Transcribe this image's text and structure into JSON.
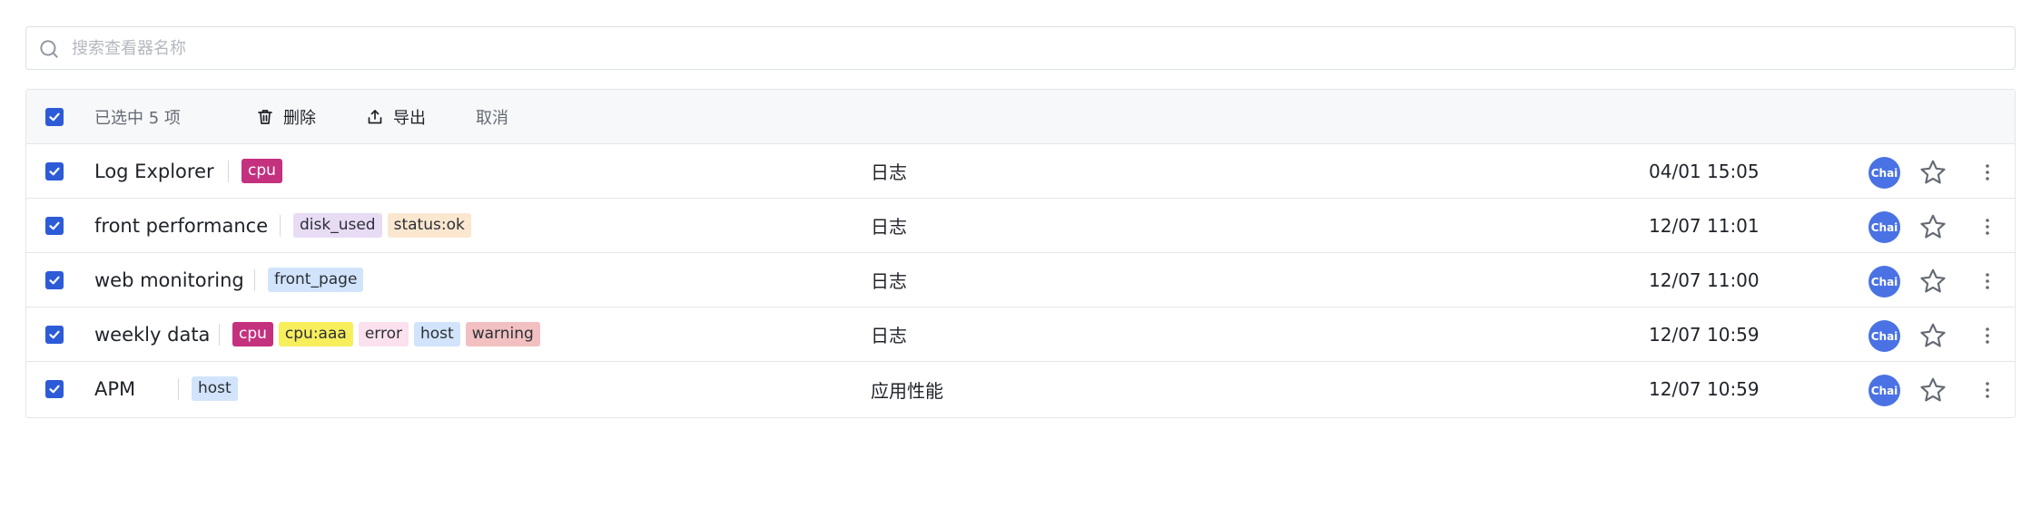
{
  "search": {
    "placeholder": "搜索查看器名称",
    "value": ""
  },
  "toolbar": {
    "selected_text": "已选中 5 项",
    "delete_label": "删除",
    "export_label": "导出",
    "cancel_label": "取消",
    "select_all_checked": true
  },
  "rows": [
    {
      "checked": true,
      "name": "Log Explorer",
      "tags": [
        {
          "text": "cpu",
          "bg": "#c4317e",
          "fg": "#ffffff"
        }
      ],
      "type": "日志",
      "time": "04/01 15:05",
      "avatar": "Chai"
    },
    {
      "checked": true,
      "name": "front performance",
      "tags": [
        {
          "text": "disk_used",
          "bg": "#e8dcf5",
          "fg": "#2b2f36"
        },
        {
          "text": "status:ok",
          "bg": "#fbe7cf",
          "fg": "#2b2f36"
        }
      ],
      "type": "日志",
      "time": "12/07 11:01",
      "avatar": "Chai"
    },
    {
      "checked": true,
      "name": "web monitoring",
      "tags": [
        {
          "text": "front_page",
          "bg": "#d2e4fb",
          "fg": "#2b2f36"
        }
      ],
      "type": "日志",
      "time": "12/07 11:00",
      "avatar": "Chai"
    },
    {
      "checked": true,
      "name": "weekly data",
      "tags": [
        {
          "text": "cpu",
          "bg": "#c4317e",
          "fg": "#ffffff"
        },
        {
          "text": "cpu:aaa",
          "bg": "#f7ee5c",
          "fg": "#2b2f36"
        },
        {
          "text": "error",
          "bg": "#fbe0ee",
          "fg": "#2b2f36"
        },
        {
          "text": "host",
          "bg": "#d2e4fb",
          "fg": "#2b2f36"
        },
        {
          "text": "warning",
          "bg": "#f2c0c0",
          "fg": "#2b2f36"
        }
      ],
      "type": "日志",
      "time": "12/07 10:59",
      "avatar": "Chai"
    },
    {
      "checked": true,
      "name": "APM",
      "tags": [
        {
          "text": "host",
          "bg": "#d2e4fb",
          "fg": "#2b2f36"
        }
      ],
      "type": "应用性能",
      "time": "12/07 10:59",
      "avatar": "Chai"
    }
  ],
  "icons": {
    "search": "search-icon",
    "delete": "trash-icon",
    "export": "export-icon",
    "star": "star-icon",
    "more": "more-vertical-icon",
    "check": "check-icon"
  },
  "colors": {
    "accent": "#2d5bd8",
    "avatar": "#4a72e4"
  }
}
